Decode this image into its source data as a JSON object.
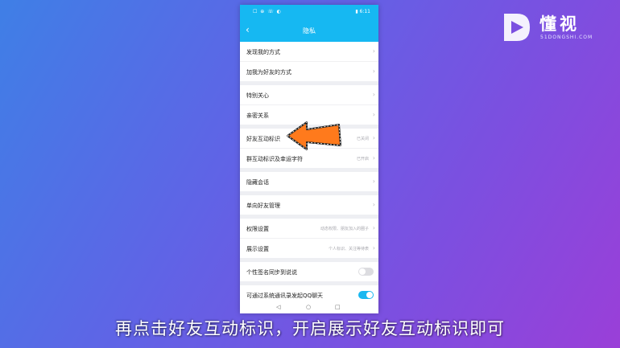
{
  "status_bar": {
    "left_icons": "☐ ⊕ ☏ ◐",
    "right_text": "▮ 6:11"
  },
  "header": {
    "back_icon": "‹",
    "title": "隐私"
  },
  "groups": [
    {
      "rows": [
        {
          "label": "发现我的方式",
          "value": "",
          "chevron": "›"
        },
        {
          "label": "加我为好友的方式",
          "value": "",
          "chevron": "›"
        }
      ]
    },
    {
      "rows": [
        {
          "label": "特别关心",
          "value": "",
          "chevron": "›"
        },
        {
          "label": "亲密关系",
          "value": "",
          "chevron": "›"
        }
      ]
    },
    {
      "rows": [
        {
          "label": "好友互动标识",
          "value": "已关闭",
          "chevron": "›"
        },
        {
          "label": "群互动标识及幸运字符",
          "value": "已开启",
          "chevron": "›"
        }
      ]
    },
    {
      "rows": [
        {
          "label": "隐藏会话",
          "value": "",
          "chevron": "›"
        }
      ]
    },
    {
      "rows": [
        {
          "label": "单向好友管理",
          "value": "",
          "chevron": "›"
        }
      ]
    },
    {
      "rows": [
        {
          "label": "权限设置",
          "value": "动态权限、朋友加入的圈子",
          "chevron": "›"
        },
        {
          "label": "展示设置",
          "value": "个人标识、关注等待表",
          "chevron": "›"
        }
      ]
    },
    {
      "rows": [
        {
          "label": "个性签名同步到说说",
          "toggle": false
        }
      ]
    },
    {
      "rows": [
        {
          "label": "可通过系统通讯录发起QQ聊天",
          "toggle": true
        }
      ]
    }
  ],
  "nav": {
    "back": "◁",
    "home": "○",
    "recent": "□"
  },
  "logo": {
    "text": "懂视",
    "sub": "51DONGSHI.COM"
  },
  "caption": "再点击好友互动标识，开启展示好友互动标识即可",
  "colors": {
    "accent": "#16b8f2",
    "arrow": "#ff7a1c",
    "toggle_on": "#19b8f0"
  }
}
